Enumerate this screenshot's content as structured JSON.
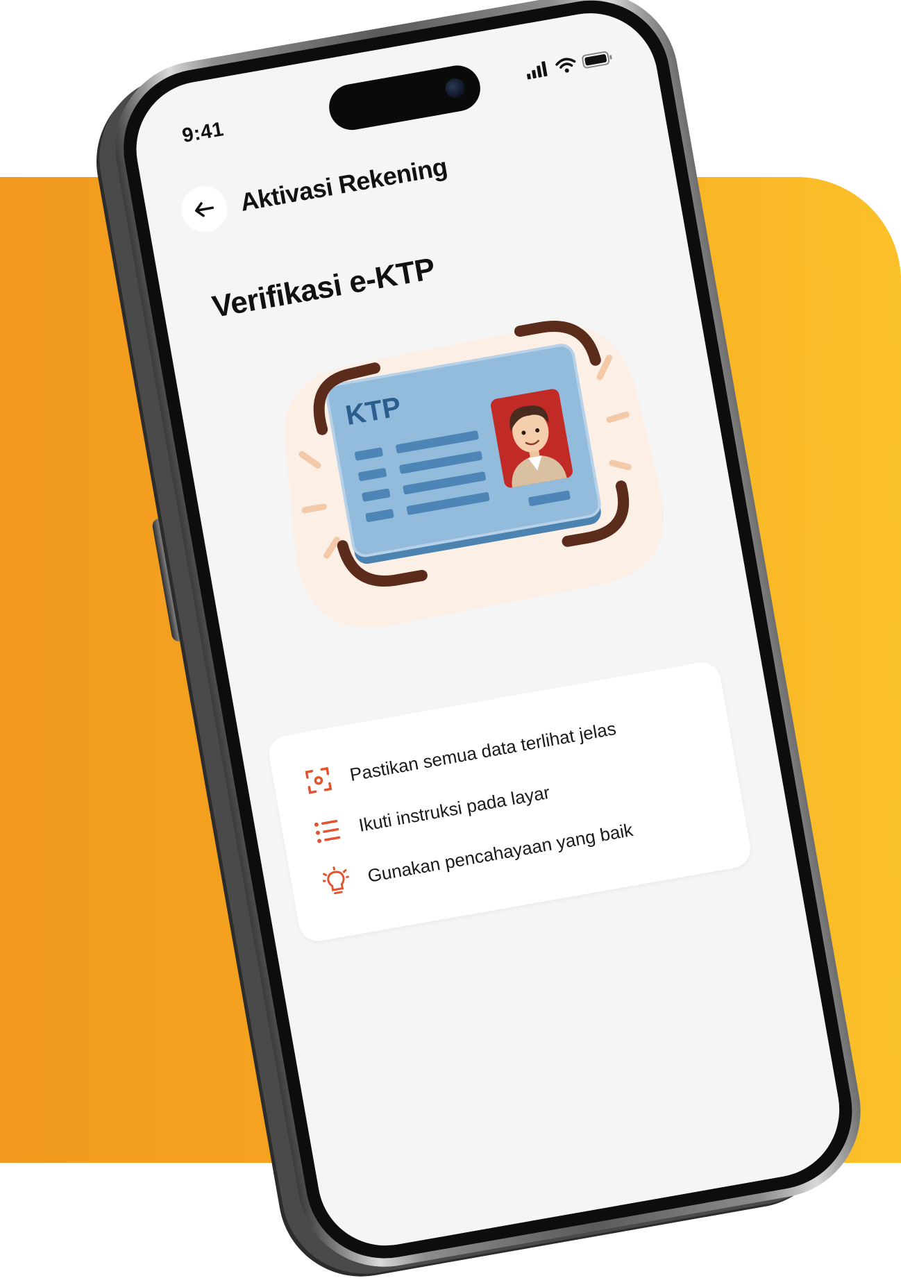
{
  "status_bar": {
    "time": "9:41"
  },
  "header": {
    "title": "Aktivasi Rekening"
  },
  "page": {
    "title": "Verifikasi e-KTP"
  },
  "id_card": {
    "label": "KTP"
  },
  "tips": [
    {
      "icon": "scan-focus-icon",
      "text": "Pastikan semua data terlihat jelas"
    },
    {
      "icon": "list-icon",
      "text": "Ikuti instruksi pada layar"
    },
    {
      "icon": "lightbulb-icon",
      "text": "Gunakan pencahayaan yang baik"
    }
  ],
  "colors": {
    "background_panel_start": "#f29a1f",
    "background_panel_end": "#fbc12a",
    "accent": "#e2542f",
    "card_blue": "#93bbdc",
    "frame_brown": "#5b2b1c",
    "screen_bg": "#f5f5f5"
  }
}
